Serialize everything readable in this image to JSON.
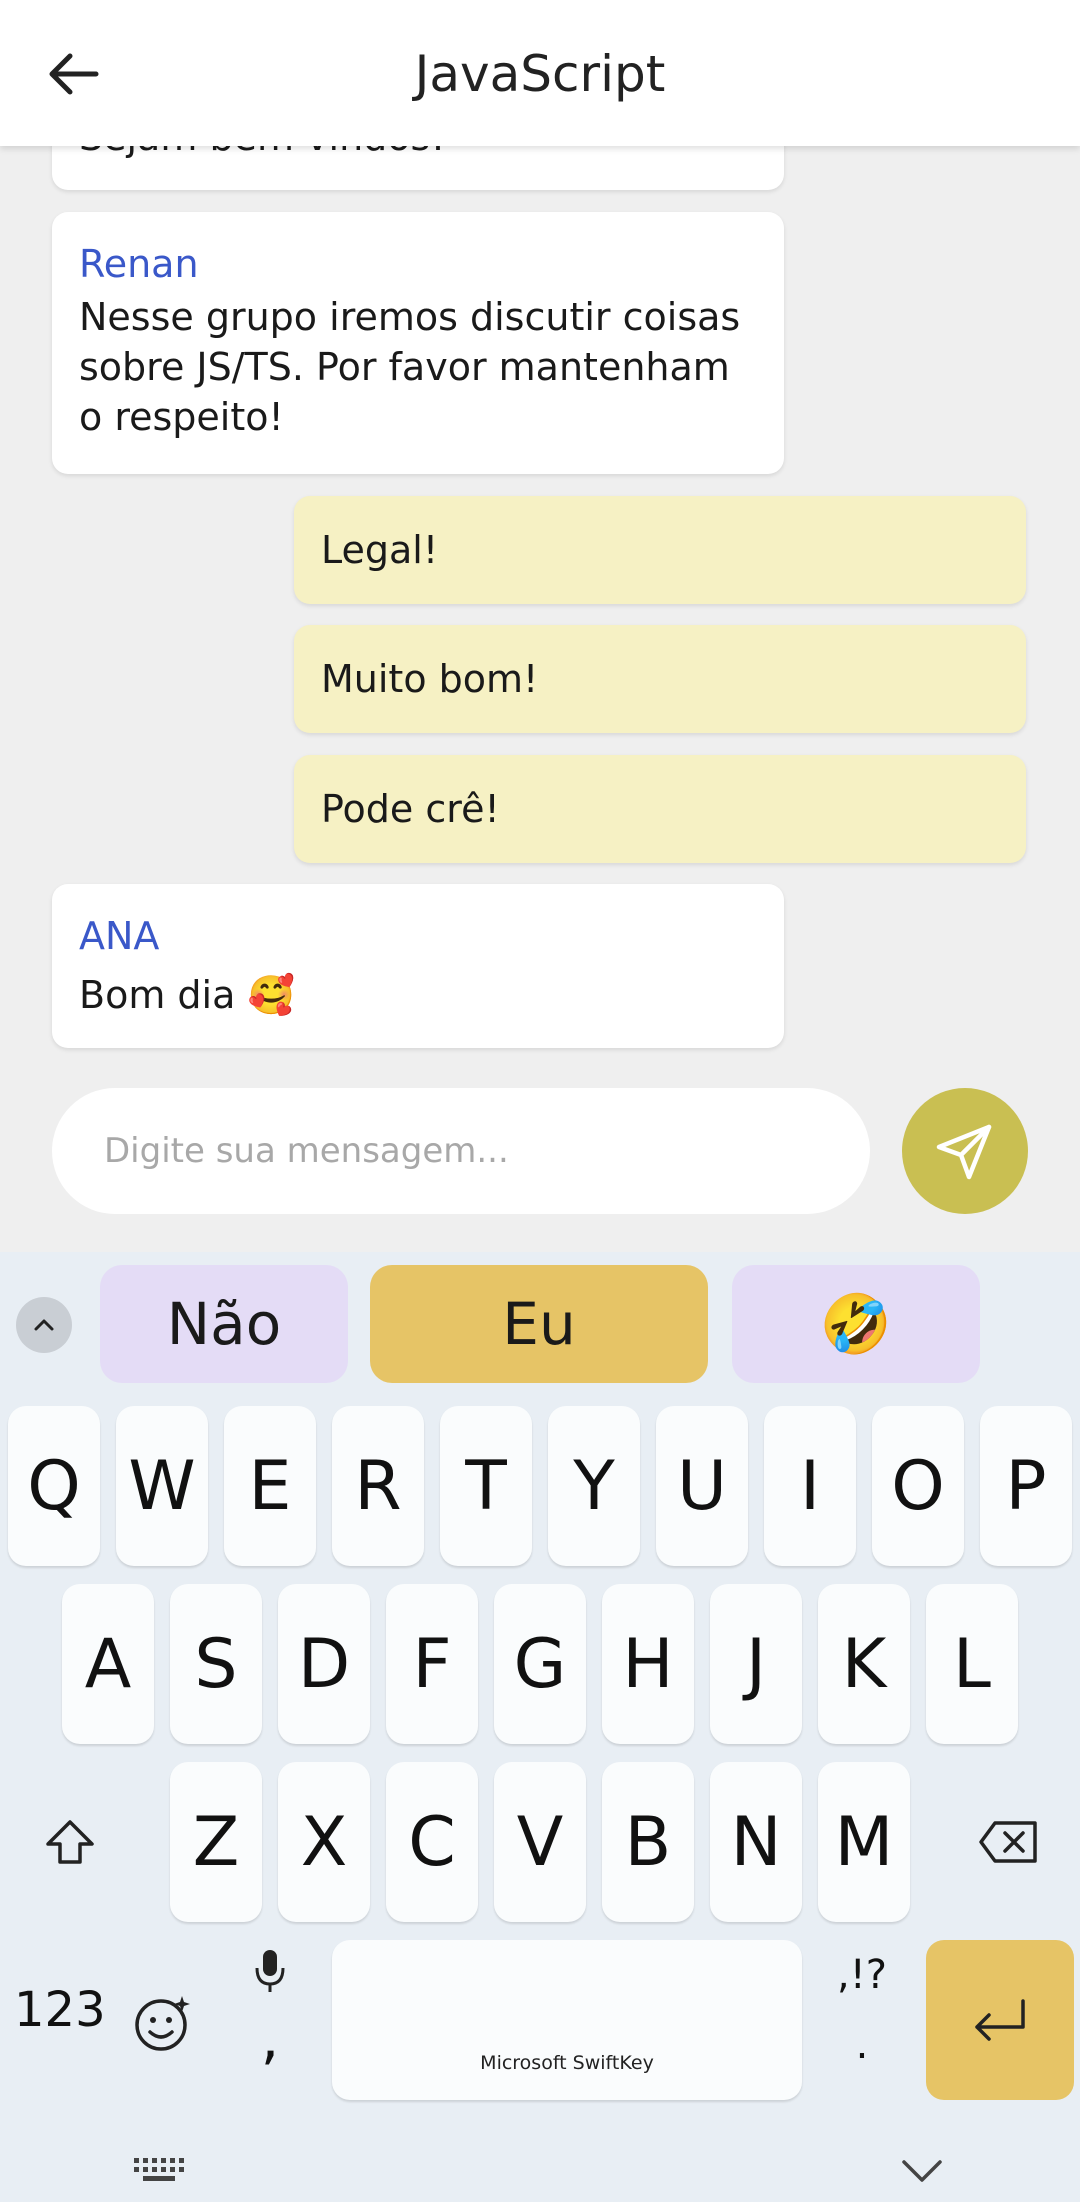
{
  "header": {
    "title": "JavaScript",
    "back_icon": "arrow-left-icon"
  },
  "messages": [
    {
      "direction": "in",
      "author": "",
      "text": "Sejam bem vindos!"
    },
    {
      "direction": "in",
      "author": "Renan",
      "text": "Nesse grupo iremos discutir coisas sobre JS/TS. Por favor mantenham o respeito!"
    },
    {
      "direction": "out",
      "author": "",
      "text": "Legal!"
    },
    {
      "direction": "out",
      "author": "",
      "text": "Muito bom!"
    },
    {
      "direction": "out",
      "author": "",
      "text": "Pode crê!"
    },
    {
      "direction": "in",
      "author": "ANA",
      "text": "Bom dia 🥰"
    }
  ],
  "composer": {
    "placeholder": "Digite sua mensagem...",
    "value": "",
    "send_icon": "send-icon"
  },
  "keyboard": {
    "suggestions": [
      "Não",
      "Eu",
      "🤣"
    ],
    "row1": [
      "Q",
      "W",
      "E",
      "R",
      "T",
      "Y",
      "U",
      "I",
      "O",
      "P"
    ],
    "row2": [
      "A",
      "S",
      "D",
      "F",
      "G",
      "H",
      "J",
      "K",
      "L"
    ],
    "row3": [
      "Z",
      "X",
      "C",
      "V",
      "B",
      "N",
      "M"
    ],
    "numbers_label": "123",
    "space_label": "Microsoft SwiftKey",
    "punct_label": ",!?",
    "dot_label": ".",
    "comma_label": ","
  },
  "colors": {
    "author": "#3a58c9",
    "outgoing_bubble": "#f6f1c4",
    "incoming_bubble": "#ffffff",
    "send_button": "#c9bf52",
    "accent_key": "#e6c466",
    "suggestion_bg": "#e4dcf6"
  }
}
